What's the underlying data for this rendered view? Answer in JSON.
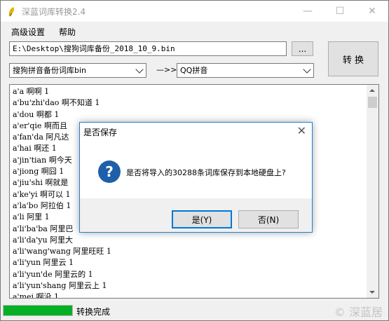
{
  "window": {
    "title": "深蓝词库转换2.4",
    "minimize": "—",
    "maximize": "☐",
    "close": "✕"
  },
  "menu": {
    "items": [
      "高级设置",
      "帮助"
    ]
  },
  "file_path": "E:\\Desktop\\搜狗词库备份_2018_10_9.bin",
  "browse_label": "...",
  "convert_label": "转 换",
  "source_format": "搜狗拼音备份词库bin",
  "arrow_label": "—>>",
  "target_format": "QQ拼音",
  "list_lines": [
    "a'a 啊啊 1",
    "a'bu'zhi'dao 啊不知道 1",
    "a'dou 啊都 1",
    "a'er'qie 啊而且",
    "a'fan'da 阿凡达",
    "a'hai 啊还 1",
    "a'jin'tian 啊今天",
    "a'jiong 啊囧 1",
    "a'jiu'shi 啊就是",
    "a'ke'yi 啊可以 1",
    "a'la'bo 阿拉伯 1",
    "a'li 阿里 1",
    "a'li'ba'ba 阿里巴",
    "a'li'da'yu 阿里大",
    "a'li'wang'wang 阿里旺旺 1",
    "a'li'yun 阿里云 1",
    "a'li'yun'de 阿里云的 1",
    "a'li'yun'shang 阿里云上 1",
    "a'mei 啊没 1"
  ],
  "status": {
    "progress_percent": 100,
    "text": "转换完成",
    "watermark": "© 深蓝居"
  },
  "dialog": {
    "title": "是否保存",
    "close": "✕",
    "icon": "question-icon",
    "message": "是否将导入的30288条词库保存到本地硬盘上?",
    "yes_label": "是(Y)",
    "no_label": "否(N)"
  },
  "colors": {
    "progress": "#06b025",
    "dialog_border": "#1883d7",
    "question_icon": "#1f5fa9"
  }
}
